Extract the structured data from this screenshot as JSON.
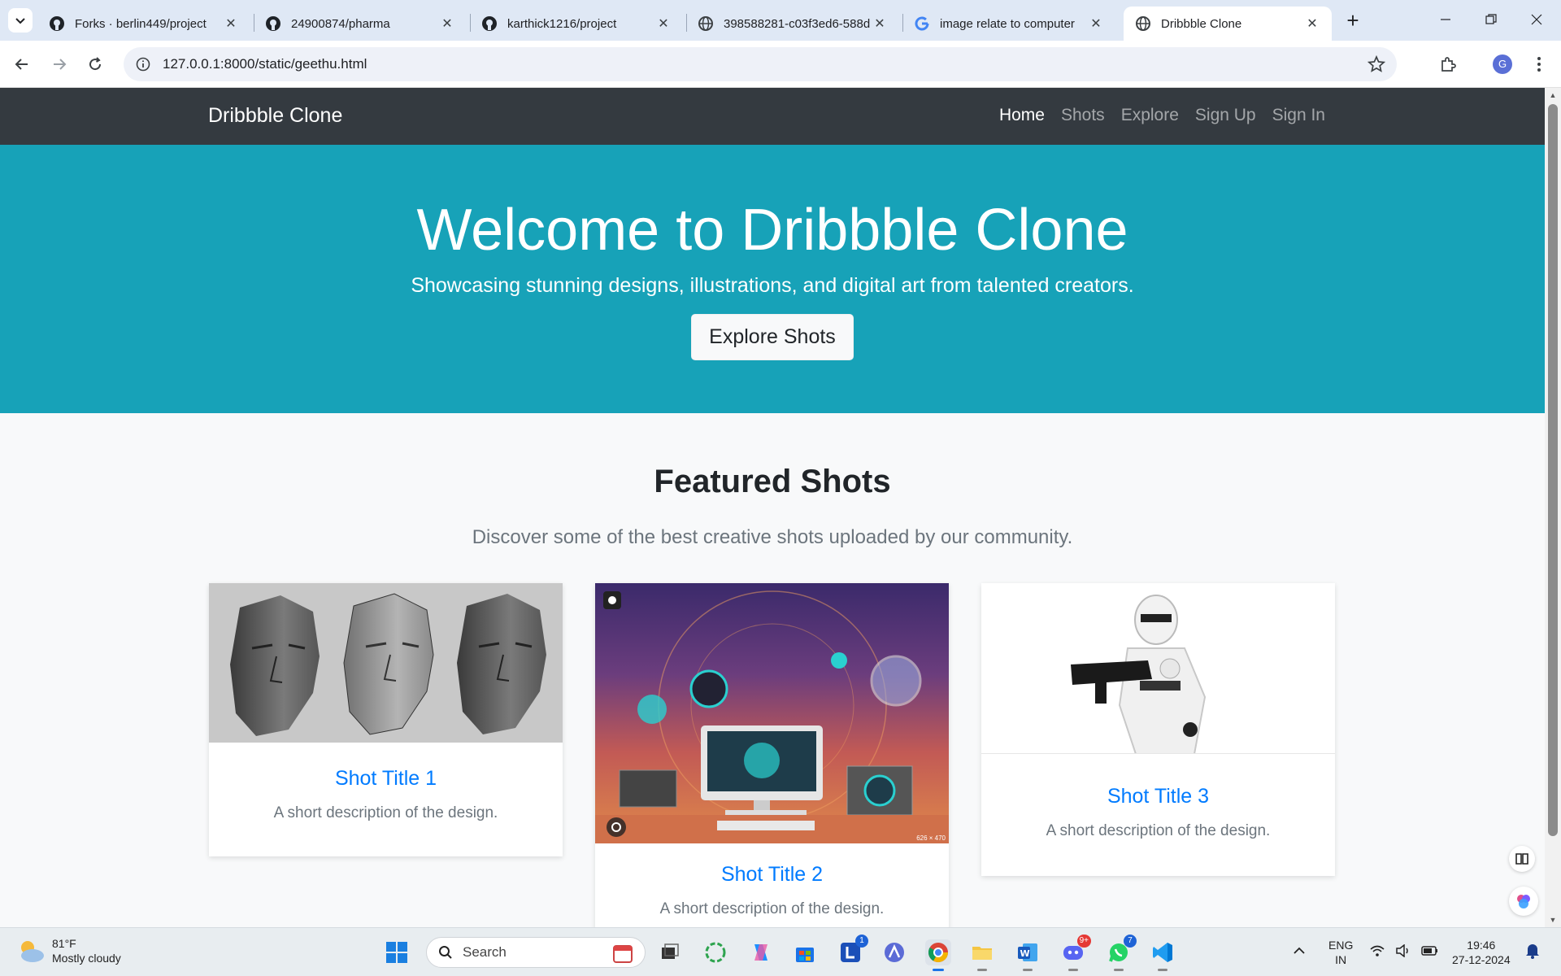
{
  "browser": {
    "tabs": [
      {
        "title": "Forks · berlin449/project",
        "icon": "github-icon"
      },
      {
        "title": "24900874/pharma",
        "icon": "github-icon"
      },
      {
        "title": "karthick1216/project",
        "icon": "github-icon"
      },
      {
        "title": "398588281-c03f3ed6-588d",
        "icon": "globe-icon"
      },
      {
        "title": "image relate to computer",
        "icon": "google-icon"
      },
      {
        "title": "Dribbble Clone",
        "icon": "globe-icon",
        "active": true
      }
    ],
    "url": "127.0.0.1:8000/static/geethu.html",
    "profile_initial": "G"
  },
  "page": {
    "brand": "Dribbble Clone",
    "nav": [
      "Home",
      "Shots",
      "Explore",
      "Sign Up",
      "Sign In"
    ],
    "hero": {
      "title": "Welcome to Dribbble Clone",
      "subtitle": "Showcasing stunning designs, illustrations, and digital art from talented creators.",
      "button": "Explore Shots"
    },
    "featured": {
      "heading": "Featured Shots",
      "lead": "Discover some of the best creative shots uploaded by our community.",
      "cards": [
        {
          "title": "Shot Title 1",
          "desc": "A short description of the design.",
          "image": "sculpted-heads-image"
        },
        {
          "title": "Shot Title 2",
          "desc": "A short description of the design.",
          "image": "computer-illustration-image",
          "image_caption": "626 × 470"
        },
        {
          "title": "Shot Title 3",
          "desc": "A short description of the design.",
          "image": "clone-trooper-image"
        }
      ]
    }
  },
  "taskbar": {
    "weather": {
      "temp": "81°F",
      "condition": "Mostly cloudy"
    },
    "search_placeholder": "Search",
    "badges": {
      "lens": "1",
      "discord": "9+",
      "whatsapp": "7"
    },
    "language": {
      "line1": "ENG",
      "line2": "IN"
    },
    "time": "19:46",
    "date": "27-12-2024"
  },
  "colors": {
    "navbar": "#343a40",
    "hero": "#17a2b8",
    "link": "#007bff",
    "tabstrip": "#dfe8f5"
  }
}
